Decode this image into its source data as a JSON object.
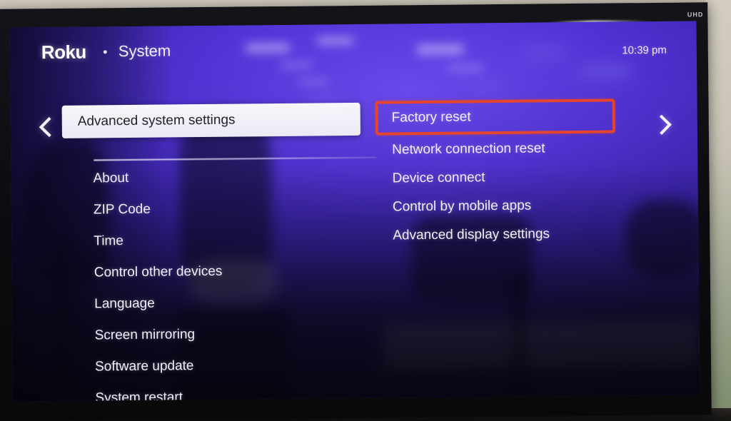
{
  "device": {
    "bezel_badge": "UHD"
  },
  "header": {
    "brand": "Roku",
    "separator_icon": "dot-separator-icon",
    "title": "System",
    "clock": "10:39 pm"
  },
  "nav": {
    "back_icon": "chevron-left-icon",
    "forward_icon": "chevron-right-icon"
  },
  "left_panel": {
    "selected": {
      "label": "Advanced system settings",
      "state": "selected"
    },
    "items": [
      {
        "label": "About"
      },
      {
        "label": "ZIP Code"
      },
      {
        "label": "Time"
      },
      {
        "label": "Control other devices"
      },
      {
        "label": "Language"
      },
      {
        "label": "Screen mirroring"
      },
      {
        "label": "Software update"
      },
      {
        "label": "System restart"
      }
    ]
  },
  "right_panel": {
    "focused": {
      "label": "Factory reset",
      "state": "highlighted"
    },
    "items": [
      {
        "label": "Network connection reset"
      },
      {
        "label": "Device connect"
      },
      {
        "label": "Control by mobile apps"
      },
      {
        "label": "Advanced display settings"
      }
    ]
  },
  "annotation": {
    "target": "Factory reset",
    "shape": "rectangle",
    "color": "#e5452e"
  },
  "colors": {
    "screen_purple": "#5334d8",
    "screen_deep": "#140c33",
    "selected_pill_bg": "#f2f0f9",
    "selected_pill_text": "#232028",
    "menu_text": "#f1eff8",
    "annotation_red": "#e5452e",
    "bezel": "#0c0c10",
    "wall": "#c9c3b5"
  }
}
